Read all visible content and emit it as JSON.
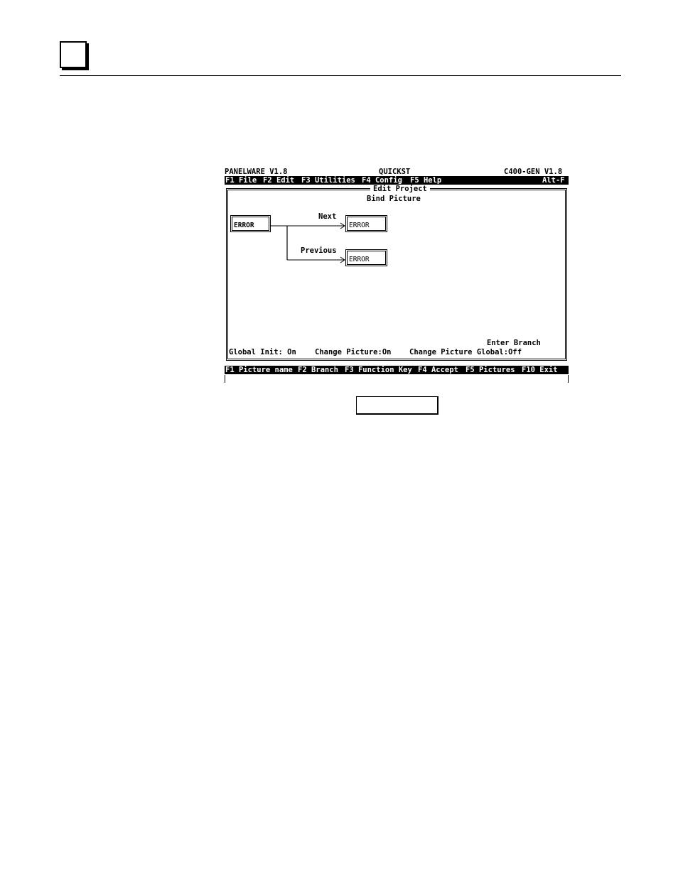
{
  "window": {
    "app_name": "PANELWARE V1.8",
    "project_name": "QUICKST",
    "target": "C400-GEN V1.8"
  },
  "menu": {
    "items": [
      {
        "label": "F1 File"
      },
      {
        "label": "F2 Edit"
      },
      {
        "label": "F3 Utilities"
      },
      {
        "label": "F4 Config"
      },
      {
        "label": "F5 Help"
      }
    ],
    "shortcut": "Alt-F"
  },
  "editor": {
    "title": "Edit Project",
    "subtitle": "Bind Picture",
    "current_picture": "ERROR",
    "branches": [
      {
        "label": "Next",
        "target": "ERROR"
      },
      {
        "label": "Previous",
        "target": "ERROR"
      }
    ],
    "prompt": "Enter Branch",
    "status": {
      "global_init": "Global Init: On",
      "change_picture": "Change Picture:On",
      "change_picture_global": "Change Picture Global:Off"
    }
  },
  "function_keys": [
    {
      "label": "F1 Picture name"
    },
    {
      "label": "F2 Branch"
    },
    {
      "label": "F3 Function Key"
    },
    {
      "label": "F4 Accept"
    },
    {
      "label": "F5 Pictures"
    },
    {
      "label": "F10 Exit"
    }
  ]
}
